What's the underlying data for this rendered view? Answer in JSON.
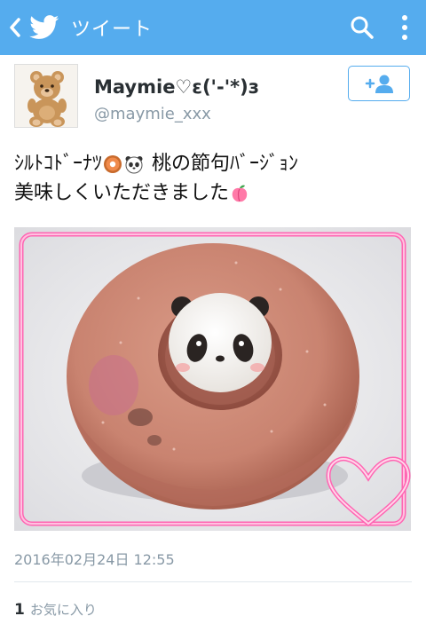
{
  "appbar": {
    "title": "ツイート",
    "back_icon": "chevron-left-icon",
    "logo_icon": "twitter-bird-icon",
    "search_icon": "search-icon",
    "menu_icon": "more-vertical-icon",
    "color": "#55acee"
  },
  "author": {
    "display_name": "Maymie♡ε('-'*)з",
    "handle": "@maymie_xxx",
    "avatar_icon": "teddy-bear-avatar",
    "follow_icon": "add-user-icon"
  },
  "tweet": {
    "line1_a": "ｼﾙﾄｺﾄﾞｰﾅﾂ",
    "line1_b": "桃の節句ﾊﾞｰｼﾞｮﾝ",
    "line2": "美味しくいただきました",
    "emojis": [
      "donut-emoji",
      "panda-emoji",
      "peach-emoji"
    ]
  },
  "photo": {
    "subject": "panda-donut-photo"
  },
  "timestamp": "2016年02月24日 12:55",
  "stats": {
    "fav_count": "1",
    "fav_label": "お気に入り"
  }
}
